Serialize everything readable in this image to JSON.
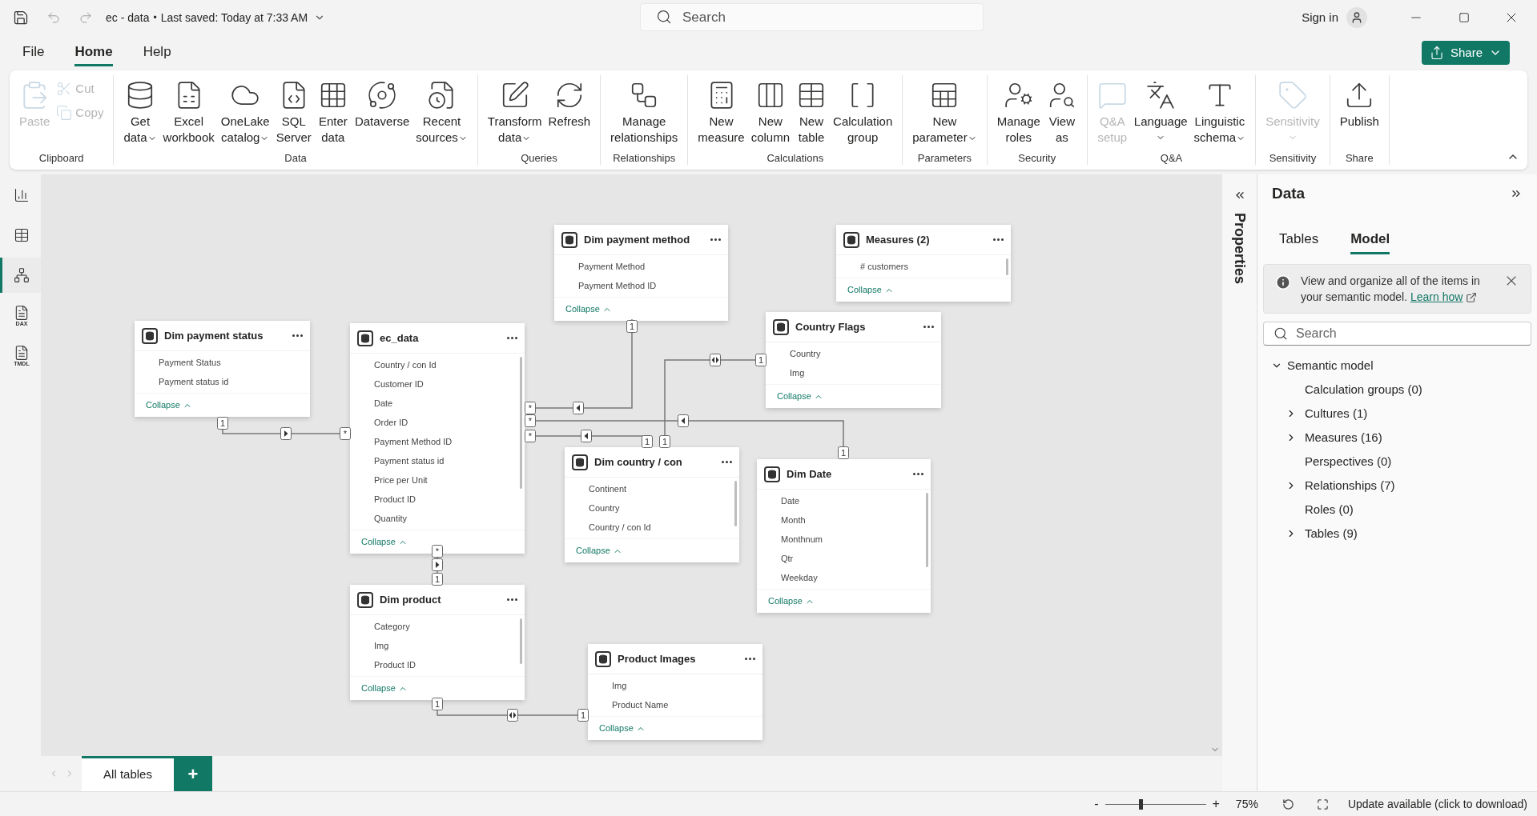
{
  "title_bar": {
    "file_name": "ec - data",
    "separator": "•",
    "saved": "Last saved: Today at 7:33 AM",
    "search": {
      "placeholder": "Search"
    },
    "sign_in": "Sign in"
  },
  "menu": [
    {
      "label": "File",
      "selected": false
    },
    {
      "label": "Home",
      "selected": true
    },
    {
      "label": "Help",
      "selected": false
    }
  ],
  "share": "Share",
  "ribbon": [
    {
      "name": "Clipboard",
      "items": [
        {
          "lines": [
            "Paste"
          ],
          "disabled": true,
          "dropdown": false,
          "kind": "large"
        },
        {
          "lines": [
            "Cut"
          ],
          "disabled": true,
          "dropdown": false,
          "kind": "small"
        },
        {
          "lines": [
            "Copy"
          ],
          "disabled": true,
          "dropdown": false,
          "kind": "small"
        }
      ]
    },
    {
      "name": "Data",
      "items": [
        {
          "lines": [
            "Get",
            "data"
          ],
          "disabled": false,
          "dropdown": true,
          "kind": "large"
        },
        {
          "lines": [
            "Excel",
            "workbook"
          ],
          "disabled": false,
          "dropdown": false,
          "kind": "large"
        },
        {
          "lines": [
            "OneLake",
            "catalog"
          ],
          "disabled": false,
          "dropdown": true,
          "kind": "large"
        },
        {
          "lines": [
            "SQL",
            "Server"
          ],
          "disabled": false,
          "dropdown": false,
          "kind": "large"
        },
        {
          "lines": [
            "Enter",
            "data"
          ],
          "disabled": false,
          "dropdown": false,
          "kind": "large"
        },
        {
          "lines": [
            "Dataverse"
          ],
          "disabled": false,
          "dropdown": false,
          "kind": "large"
        },
        {
          "lines": [
            "Recent",
            "sources"
          ],
          "disabled": false,
          "dropdown": true,
          "kind": "large"
        }
      ]
    },
    {
      "name": "Queries",
      "items": [
        {
          "lines": [
            "Transform",
            "data"
          ],
          "disabled": false,
          "dropdown": true,
          "kind": "large"
        },
        {
          "lines": [
            "Refresh"
          ],
          "disabled": false,
          "dropdown": false,
          "kind": "large"
        }
      ]
    },
    {
      "name": "Relationships",
      "items": [
        {
          "lines": [
            "Manage",
            "relationships"
          ],
          "disabled": false,
          "dropdown": false,
          "kind": "large"
        }
      ]
    },
    {
      "name": "Calculations",
      "items": [
        {
          "lines": [
            "New",
            "measure"
          ],
          "disabled": false,
          "dropdown": false,
          "kind": "large"
        },
        {
          "lines": [
            "New",
            "column"
          ],
          "disabled": false,
          "dropdown": false,
          "kind": "large"
        },
        {
          "lines": [
            "New",
            "table"
          ],
          "disabled": false,
          "dropdown": false,
          "kind": "large"
        },
        {
          "lines": [
            "Calculation",
            "group"
          ],
          "disabled": false,
          "dropdown": false,
          "kind": "large"
        }
      ]
    },
    {
      "name": "Parameters",
      "items": [
        {
          "lines": [
            "New",
            "parameter"
          ],
          "disabled": false,
          "dropdown": true,
          "kind": "large"
        }
      ]
    },
    {
      "name": "Security",
      "items": [
        {
          "lines": [
            "Manage",
            "roles"
          ],
          "disabled": false,
          "dropdown": false,
          "kind": "large"
        },
        {
          "lines": [
            "View",
            "as"
          ],
          "disabled": false,
          "dropdown": false,
          "kind": "large"
        }
      ]
    },
    {
      "name": "Q&A",
      "items": [
        {
          "lines": [
            "Q&A",
            "setup"
          ],
          "disabled": true,
          "dropdown": false,
          "kind": "large"
        },
        {
          "lines": [
            "Language"
          ],
          "disabled": false,
          "dropdown": true,
          "kind": "large"
        },
        {
          "lines": [
            "Linguistic",
            "schema"
          ],
          "disabled": false,
          "dropdown": true,
          "kind": "large"
        }
      ]
    },
    {
      "name": "Sensitivity",
      "items": [
        {
          "lines": [
            "Sensitivity"
          ],
          "disabled": true,
          "dropdown": true,
          "kind": "large"
        }
      ]
    },
    {
      "name": "Share",
      "items": [
        {
          "lines": [
            "Publish"
          ],
          "disabled": false,
          "dropdown": false,
          "kind": "large"
        }
      ]
    }
  ],
  "left_nav": [
    {
      "selected": false
    },
    {
      "selected": false
    },
    {
      "selected": true
    },
    {
      "badge": "DAX",
      "selected": false
    },
    {
      "badge": "TMDL",
      "selected": false
    }
  ],
  "tables": [
    {
      "name": "Dim payment method",
      "fields": [
        "Payment Method",
        "Payment Method ID"
      ],
      "collapse": "Collapse",
      "scrollable": false
    },
    {
      "name": "Measures (2)",
      "fields": [
        "# customers"
      ],
      "collapse": "Collapse",
      "scrollable": true
    },
    {
      "name": "Dim payment status",
      "fields": [
        "Payment Status",
        "Payment status id"
      ],
      "collapse": "Collapse",
      "scrollable": false
    },
    {
      "name": "ec_data",
      "fields": [
        "Country / con Id",
        "Customer ID",
        "Date",
        "Order ID",
        "Payment Method ID",
        "Payment status id",
        "Price per Unit",
        "Product ID",
        "Quantity"
      ],
      "collapse": "Collapse",
      "scrollable": true
    },
    {
      "name": "Country Flags",
      "fields": [
        "Country",
        "Img"
      ],
      "collapse": "Collapse",
      "scrollable": false
    },
    {
      "name": "Dim country / con",
      "fields": [
        "Continent",
        "Country",
        "Country / con Id"
      ],
      "collapse": "Collapse",
      "scrollable": true
    },
    {
      "name": "Dim Date",
      "fields": [
        "Date",
        "Month",
        "Monthnum",
        "Qtr",
        "Weekday"
      ],
      "collapse": "Collapse",
      "scrollable": true
    },
    {
      "name": "Dim product",
      "fields": [
        "Category",
        "Img",
        "Product ID"
      ],
      "collapse": "Collapse",
      "scrollable": true
    },
    {
      "name": "Product Images",
      "fields": [
        "Img",
        "Product Name"
      ],
      "collapse": "Collapse",
      "scrollable": false
    }
  ],
  "relationships": [
    {
      "ends": [
        "1",
        "*"
      ],
      "bidirectional": false
    },
    {
      "ends": [
        "*",
        "1"
      ],
      "bidirectional": false
    },
    {
      "ends": [
        "*",
        "1"
      ],
      "bidirectional": false
    },
    {
      "ends": [
        "*",
        "1"
      ],
      "bidirectional": false
    },
    {
      "ends": [
        "1",
        "1"
      ],
      "bidirectional": true
    },
    {
      "ends": [
        "*",
        "1"
      ],
      "bidirectional": false
    },
    {
      "ends": [
        "1",
        "1"
      ],
      "bidirectional": true
    }
  ],
  "page_tabs": [
    {
      "label": "All tables",
      "selected": true
    }
  ],
  "add_tab": "+",
  "properties_pane": {
    "title": "Properties"
  },
  "data_pane": {
    "title": "Data",
    "tabs": [
      {
        "label": "Tables",
        "selected": false
      },
      {
        "label": "Model",
        "selected": true
      }
    ],
    "info": {
      "text": "View and organize all of the items in your semantic model.",
      "link": "Learn how"
    },
    "search": {
      "placeholder": "Search"
    },
    "tree": [
      {
        "label": "Semantic model",
        "expanded": true,
        "children": [
          {
            "label": "Calculation groups (0)",
            "expandable": false
          },
          {
            "label": "Cultures (1)",
            "expandable": true
          },
          {
            "label": "Measures (16)",
            "expandable": true
          },
          {
            "label": "Perspectives (0)",
            "expandable": false
          },
          {
            "label": "Relationships (7)",
            "expandable": true
          },
          {
            "label": "Roles (0)",
            "expandable": false
          },
          {
            "label": "Tables (9)",
            "expandable": true
          }
        ]
      }
    ]
  },
  "status_bar": {
    "zoom_out": "-",
    "zoom_in": "+",
    "zoom": {
      "level": 0.35
    },
    "zoom_reading": "75%",
    "update": "Update available (click to download)"
  }
}
